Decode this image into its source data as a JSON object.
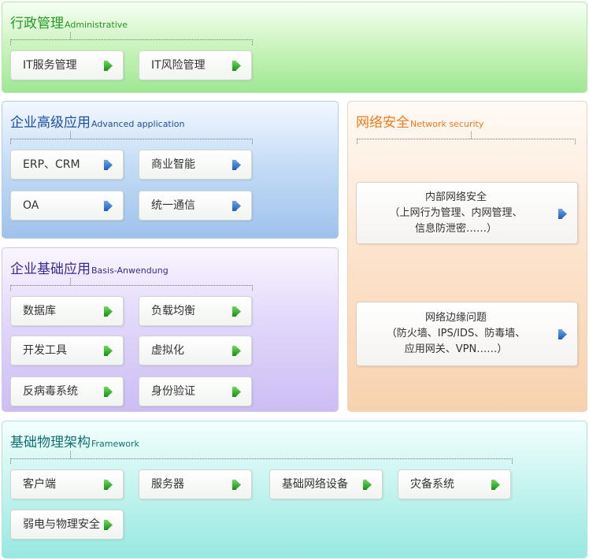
{
  "admin": {
    "title": "行政管理",
    "title_en": "Administrative",
    "items": [
      "IT服务管理",
      "IT风险管理"
    ]
  },
  "advanced": {
    "title": "企业高级应用",
    "title_en": "Advanced application",
    "items": [
      "ERP、CRM",
      "商业智能",
      "OA",
      "统一通信"
    ]
  },
  "basis": {
    "title": "企业基础应用",
    "title_en": "Basis-Anwendung",
    "items": [
      "数据库",
      "负载均衡",
      "开发工具",
      "虚拟化",
      "反病毒系统",
      "身份验证"
    ]
  },
  "network": {
    "title": "网络安全",
    "title_en": "Network security",
    "blocks": [
      {
        "lines": [
          "内部网络安全",
          "（上网行为管理、内网管理、",
          "信息防泄密……）"
        ]
      },
      {
        "lines": [
          "网络边缘问题",
          "（防火墙、IPS/IDS、防毒墙、",
          "应用网关、VPN……）"
        ]
      }
    ]
  },
  "framework": {
    "title": "基础物理架构",
    "title_en": "Framework",
    "items": [
      "客户端",
      "服务器",
      "基础网络设备",
      "灾备系统",
      "弱电与物理安全"
    ]
  },
  "colors": {
    "arrow_blue": "#2a6cc8",
    "arrow_green": "#2aa02a"
  },
  "icons": {
    "arrow": "play-arrow-icon"
  }
}
